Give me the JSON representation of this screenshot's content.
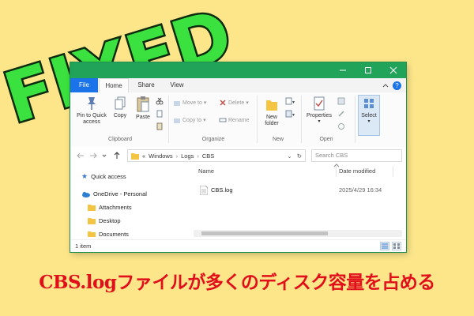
{
  "banner": {
    "text": "FIXED",
    "fill": "#3be23f",
    "outline": "#0d2b0f"
  },
  "window": {
    "tabs": [
      "File",
      "Home",
      "Share",
      "View"
    ],
    "ribbon": {
      "clipboard": {
        "pin": "Pin to Quick access",
        "copy": "Copy",
        "paste": "Paste",
        "label": "Clipboard"
      },
      "organize": {
        "move_to": "Move to",
        "copy_to": "Copy to",
        "delete": "Delete",
        "rename": "Rename",
        "label": "Organize"
      },
      "new": {
        "new_folder": "New folder",
        "label": "New"
      },
      "open": {
        "properties": "Properties",
        "label": "Open"
      },
      "select": {
        "select": "Select"
      }
    },
    "address": {
      "prefix": "«",
      "segments": [
        "Windows",
        "Logs",
        "CBS"
      ],
      "search_placeholder": "Search CBS"
    },
    "nav": {
      "quick_access": "Quick access",
      "onedrive": "OneDrive - Personal",
      "folders": [
        "Attachments",
        "Desktop",
        "Documents"
      ]
    },
    "columns": {
      "name": "Name",
      "date": "Date modified"
    },
    "files": [
      {
        "name": "CBS.log",
        "date": "2025/4/29 16:34"
      }
    ],
    "status": "1 item"
  },
  "caption": "CBS.logファイルが多くのディスク容量を占める",
  "colors": {
    "background": "#fde68a",
    "titlebar": "#21a45a",
    "caption": "#e10f1a",
    "accent": "#1a73e8"
  }
}
